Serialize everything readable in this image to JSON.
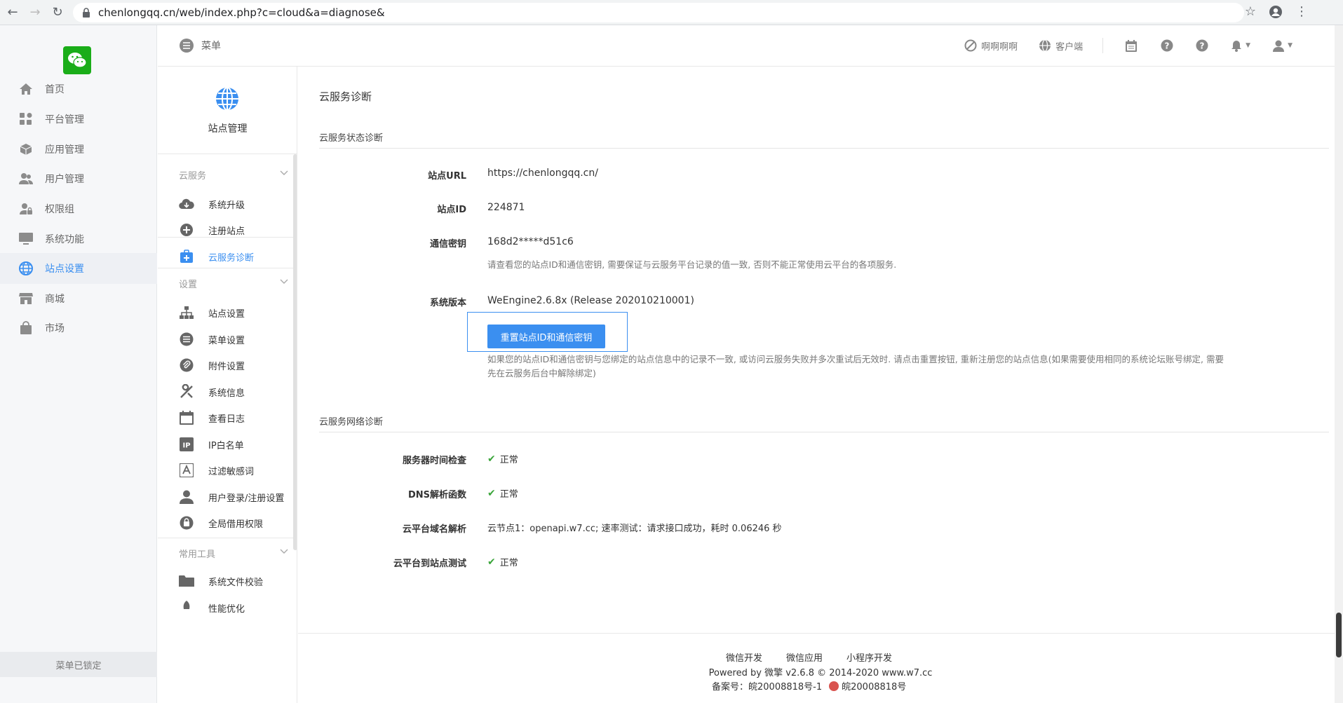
{
  "browser": {
    "url": "chenlongqq.cn/web/index.php?c=cloud&a=diagnose&"
  },
  "sidebar": {
    "items": [
      {
        "label": "首页",
        "icon": "home-icon"
      },
      {
        "label": "平台管理",
        "icon": "grid-icon"
      },
      {
        "label": "应用管理",
        "icon": "box-icon"
      },
      {
        "label": "用户管理",
        "icon": "users-icon"
      },
      {
        "label": "权限组",
        "icon": "user-lock-icon"
      },
      {
        "label": "系统功能",
        "icon": "monitor-icon"
      },
      {
        "label": "站点设置",
        "icon": "globe-icon",
        "active": true
      },
      {
        "label": "商城",
        "icon": "store-icon"
      },
      {
        "label": "市场",
        "icon": "bag-icon"
      }
    ],
    "locked_label": "菜单已锁定"
  },
  "header": {
    "menu_label": "菜单",
    "links": [
      {
        "label": "啊啊啊啊",
        "icon": "compass-icon"
      },
      {
        "label": "客户端",
        "icon": "globe-small-icon"
      }
    ]
  },
  "subsidebar": {
    "title": "站点管理",
    "groups": [
      {
        "title": "云服务",
        "items": [
          {
            "label": "系统升级",
            "icon": "cloud-download-icon"
          },
          {
            "label": "注册站点",
            "icon": "plus-circle-icon"
          },
          {
            "label": "云服务诊断",
            "icon": "medical-box-icon",
            "active": true
          }
        ]
      },
      {
        "title": "设置",
        "items": [
          {
            "label": "站点设置",
            "icon": "sitemap-icon"
          },
          {
            "label": "菜单设置",
            "icon": "list-icon"
          },
          {
            "label": "附件设置",
            "icon": "paperclip-icon"
          },
          {
            "label": "系统信息",
            "icon": "tools-icon"
          },
          {
            "label": "查看日志",
            "icon": "calendar-icon"
          },
          {
            "label": "IP白名单",
            "icon": "ip-icon"
          },
          {
            "label": "过滤敏感词",
            "icon": "font-icon"
          },
          {
            "label": "用户登录/注册设置",
            "icon": "user-icon"
          },
          {
            "label": "全局借用权限",
            "icon": "shield-icon"
          }
        ]
      },
      {
        "title": "常用工具",
        "items": [
          {
            "label": "系统文件校验",
            "icon": "folder-icon"
          },
          {
            "label": "性能优化",
            "icon": "rocket-icon"
          }
        ]
      }
    ]
  },
  "main": {
    "page_title": "云服务诊断",
    "status_section": {
      "title": "云服务状态诊断",
      "rows": [
        {
          "label": "站点URL",
          "value": "https://chenlongqq.cn/"
        },
        {
          "label": "站点ID",
          "value": "224871"
        },
        {
          "label": "通信密钥",
          "value": "168d2*****d51c6",
          "note": "请查看您的站点ID和通信密钥, 需要保证与云服务平台记录的值一致, 否则不能正常使用云平台的各项服务."
        },
        {
          "label": "系统版本",
          "value": "WeEngine2.6.8x (Release 202010210001)"
        }
      ],
      "reset_button": "重置站点ID和通信密钥",
      "reset_note_line1": "如果您的站点ID和通信密钥与您绑定的站点信息中的记录不一致, 或访问云服务失败并多次重试后无效时. 请点击重置按钮, 重新注册您的站点信息(如果需要使用相同的系统论坛账号绑定, 需要",
      "reset_note_line2": "先在云服务后台中解除绑定)"
    },
    "network_section": {
      "title": "云服务网络诊断",
      "rows": [
        {
          "label": "服务器时间检查",
          "value": "正常",
          "ok": true
        },
        {
          "label": "DNS解析函数",
          "value": "正常",
          "ok": true
        },
        {
          "label": "云平台域名解析",
          "value": "云节点1：openapi.w7.cc; 速率测试：请求接口成功，耗时 0.06246 秒",
          "ok": false
        },
        {
          "label": "云平台到站点测试",
          "value": "正常",
          "ok": true
        }
      ]
    }
  },
  "footer": {
    "links": [
      "微信开发",
      "微信应用",
      "小程序开发"
    ],
    "powered": "Powered by 微擎 v2.6.8 © 2014-2020 www.w7.cc",
    "record1": "备案号：皖20008818号-1",
    "record2": "皖20008818号"
  }
}
